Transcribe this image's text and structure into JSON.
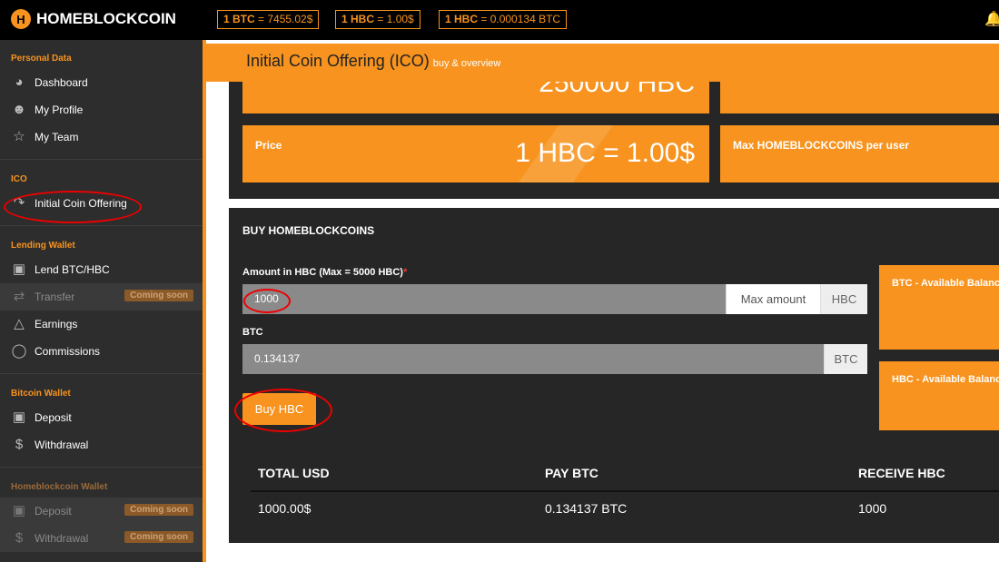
{
  "brand": {
    "name": "HOMEBLOCKCOIN",
    "logo_letter": "H"
  },
  "rates": [
    {
      "coin": "1 BTC",
      "value": "= 7455.02$"
    },
    {
      "coin": "1 HBC",
      "value": "= 1.00$"
    },
    {
      "coin": "1 HBC",
      "value": "= 0.000134 BTC"
    }
  ],
  "sidebar": {
    "personal": {
      "title": "Personal Data",
      "items": [
        {
          "label": "Dashboard",
          "icon": "dashboard-icon"
        },
        {
          "label": "My Profile",
          "icon": "user-icon"
        },
        {
          "label": "My Team",
          "icon": "star-icon"
        }
      ]
    },
    "ico": {
      "title": "ICO",
      "items": [
        {
          "label": "Initial Coin Offering",
          "icon": "share-icon"
        }
      ]
    },
    "lending": {
      "title": "Lending Wallet",
      "items": [
        {
          "label": "Lend BTC/HBC",
          "icon": "card-icon"
        },
        {
          "label": "Transfer",
          "icon": "transfer-icon",
          "badge": "Coming soon"
        },
        {
          "label": "Earnings",
          "icon": "tower-icon"
        },
        {
          "label": "Commissions",
          "icon": "globe-icon"
        }
      ]
    },
    "bitcoin": {
      "title": "Bitcoin Wallet",
      "items": [
        {
          "label": "Deposit",
          "icon": "card-icon"
        },
        {
          "label": "Withdrawal",
          "icon": "dollar-icon"
        }
      ]
    },
    "hbcwallet": {
      "title": "Homeblockcoin Wallet",
      "items": [
        {
          "label": "Deposit",
          "icon": "card-icon",
          "badge": "Coming soon"
        },
        {
          "label": "Withdrawal",
          "icon": "dollar-icon",
          "badge": "Coming soon"
        }
      ]
    }
  },
  "page": {
    "title": "Initial Coin Offering (ICO)",
    "subtitle": "buy & overview"
  },
  "stats": {
    "top_value": "250000 HBC",
    "price_label": "Price",
    "price_value": "1 HBC = 1.00$",
    "max_label": "Max HOMEBLOCKCOINS per user"
  },
  "buy": {
    "title": "BUY HOMEBLOCKCOINS",
    "amount_label": "Amount in HBC (Max = 5000 HBC)",
    "required_mark": "*",
    "amount_value": "1000",
    "max_amount": "Max amount",
    "amount_unit": "HBC",
    "btc_label": "BTC",
    "btc_value": "0.134137",
    "btc_unit": "BTC",
    "button": "Buy HBC",
    "btc_balance_label": "BTC - Available Balance",
    "hbc_balance_label": "HBC - Available Balance"
  },
  "summary": {
    "headers": [
      "TOTAL USD",
      "PAY BTC",
      "RECEIVE HBC"
    ],
    "values": [
      "1000.00$",
      "0.134137 BTC",
      "1000"
    ]
  },
  "colors": {
    "accent": "#f7931e",
    "sidebar": "#2d2d2d",
    "annotation": "#e00000"
  }
}
